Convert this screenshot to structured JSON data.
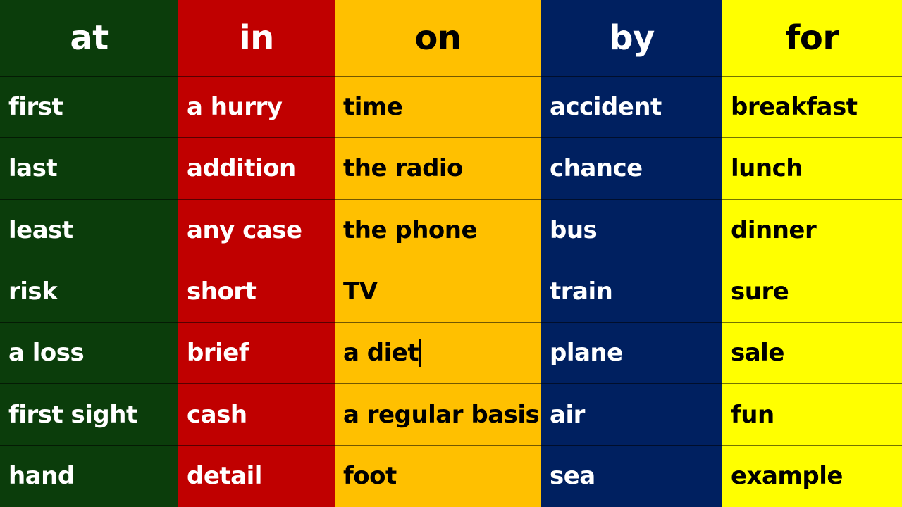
{
  "colors": {
    "at": "#0b3d0b",
    "in": "#c00000",
    "on": "#ffc000",
    "by": "#002060",
    "for": "#ffff00"
  },
  "columns": [
    {
      "header": "at",
      "text_color": "#ffffff",
      "items": [
        "first",
        "last",
        "least",
        "risk",
        "a loss",
        "first sight",
        "hand"
      ]
    },
    {
      "header": "in",
      "text_color": "#ffffff",
      "items": [
        "a hurry",
        "addition",
        "any case",
        "short",
        "brief",
        "cash",
        "detail"
      ]
    },
    {
      "header": "on",
      "text_color": "#000000",
      "items": [
        "time",
        "the radio",
        "the phone",
        "TV",
        "a diet",
        "a regular basis",
        "foot"
      ]
    },
    {
      "header": "by",
      "text_color": "#ffffff",
      "items": [
        "accident",
        "chance",
        "bus",
        "train",
        "plane",
        "air",
        "sea"
      ]
    },
    {
      "header": "for",
      "text_color": "#000000",
      "items": [
        "breakfast",
        "lunch",
        "dinner",
        "sure",
        "sale",
        "fun",
        "example"
      ]
    }
  ]
}
